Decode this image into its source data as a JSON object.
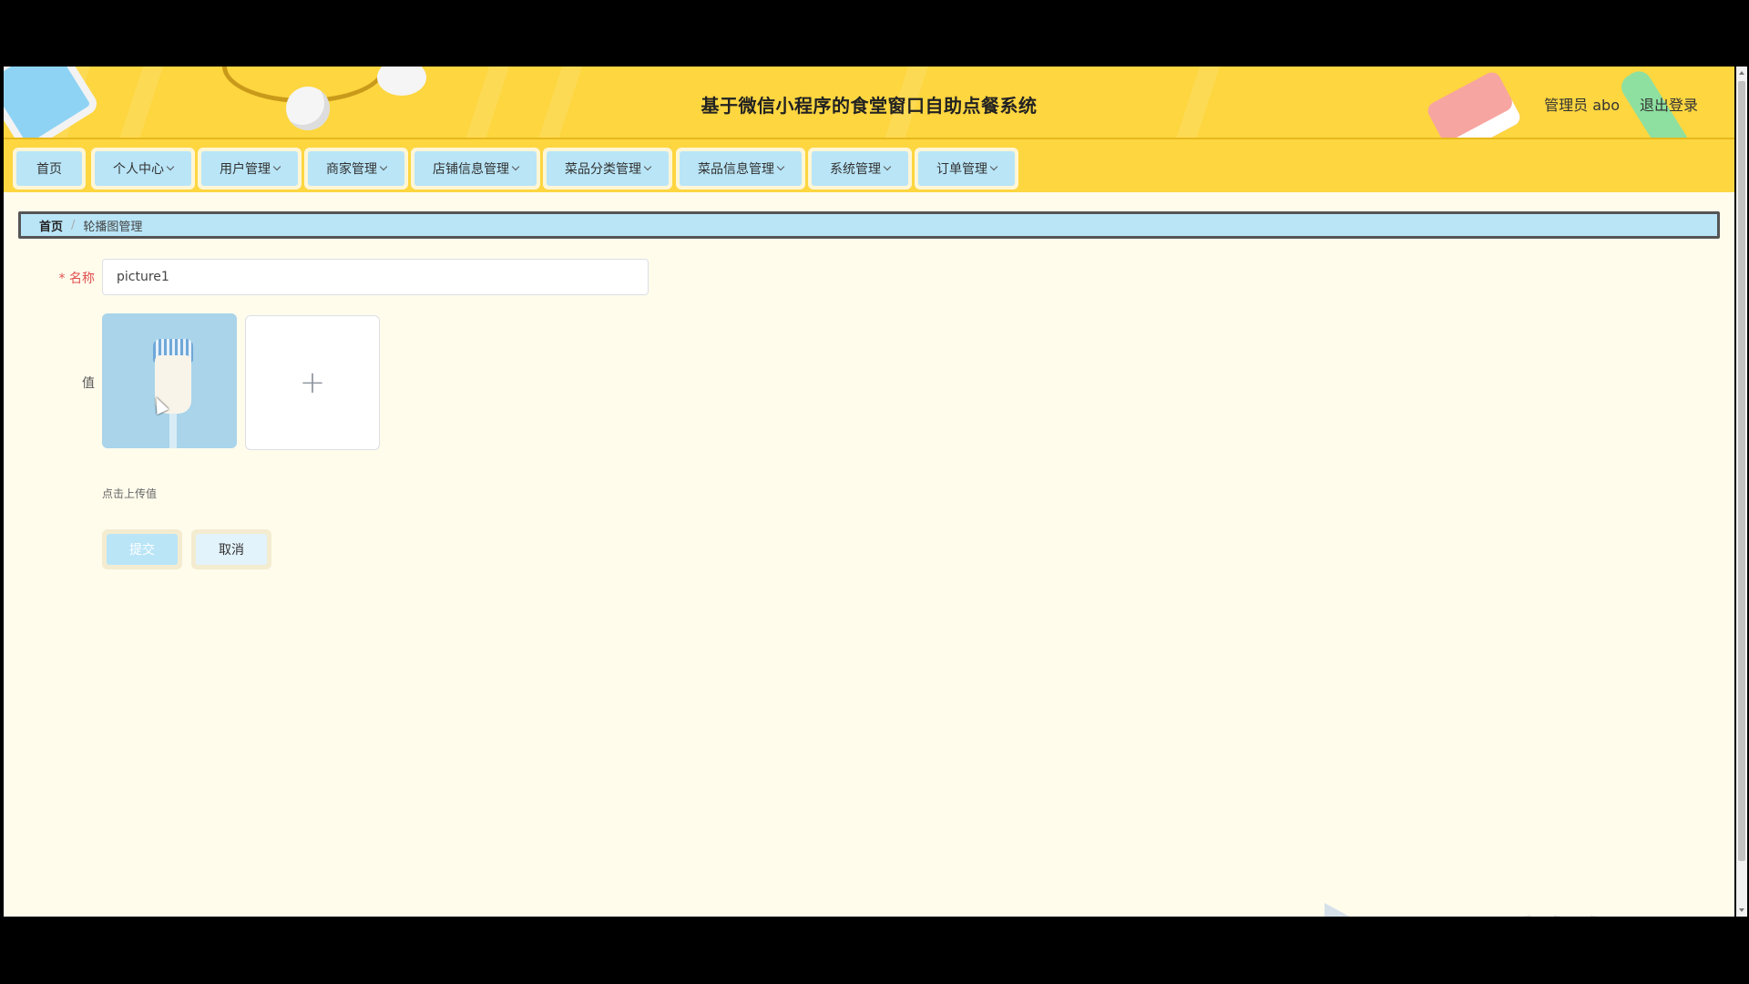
{
  "header": {
    "title": "基于微信小程序的食堂窗口自助点餐系统",
    "user": "管理员 abo",
    "logout": "退出登录"
  },
  "nav": {
    "items": [
      {
        "label": "首页"
      },
      {
        "label": "个人中心"
      },
      {
        "label": "用户管理"
      },
      {
        "label": "商家管理"
      },
      {
        "label": "店铺信息管理"
      },
      {
        "label": "菜品分类管理"
      },
      {
        "label": "菜品信息管理"
      },
      {
        "label": "系统管理"
      },
      {
        "label": "订单管理"
      }
    ]
  },
  "breadcrumb": {
    "home": "首页",
    "separator": "/",
    "current": "轮播图管理"
  },
  "form": {
    "name_label": "名称",
    "name_required": "*",
    "name_value": "picture1",
    "value_label": "值",
    "upload_plus": "+",
    "upload_hint": "点击上传值",
    "submit": "提交",
    "cancel": "取消"
  },
  "watermark": "ev剪辑",
  "colors": {
    "header_bg": "#fdd640",
    "nav_button": "#b9e5f7",
    "page_bg": "#fffcec",
    "required": "#e05050"
  }
}
